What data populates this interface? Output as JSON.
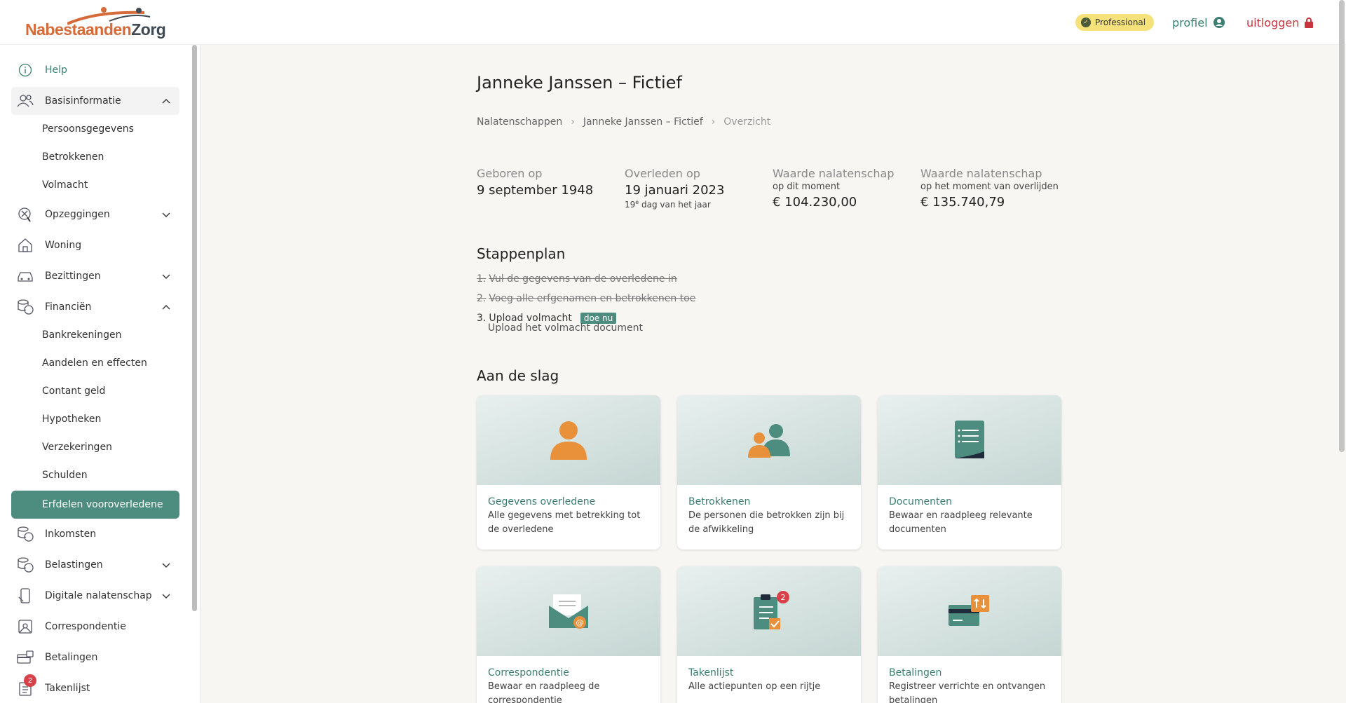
{
  "brand": {
    "part1": "Nabestaanden",
    "part2": "Zorg"
  },
  "header": {
    "badge": "Professional",
    "profile_label": "profiel",
    "logout_label": "uitloggen"
  },
  "sidebar": {
    "help": "Help",
    "basis": "Basisinformatie",
    "basis_items": [
      "Persoonsgegevens",
      "Betrokkenen",
      "Volmacht"
    ],
    "opzeggingen": "Opzeggingen",
    "woning": "Woning",
    "bezittingen": "Bezittingen",
    "financien": "Financiën",
    "financien_items": [
      "Bankrekeningen",
      "Aandelen en effecten",
      "Contant geld",
      "Hypotheken",
      "Verzekeringen",
      "Schulden",
      "Erfdelen vooroverledene"
    ],
    "inkomsten": "Inkomsten",
    "belastingen": "Belastingen",
    "digitaal": "Digitale nalatenschap",
    "correspondentie": "Correspondentie",
    "betalingen": "Betalingen",
    "takenlijst": "Takenlijst",
    "takenlijst_badge": "2"
  },
  "page": {
    "title": "Janneke Janssen – Fictief",
    "breadcrumb": [
      "Nalatenschappen",
      "Janneke Janssen – Fictief",
      "Overzicht"
    ]
  },
  "facts": {
    "born_label": "Geboren op",
    "born_value": "9 september 1948",
    "died_label": "Overleden op",
    "died_value": "19 januari 2023",
    "died_note_num": "19",
    "died_note_sup": "e",
    "died_note_text": "dag van het jaar",
    "value_now_label": "Waarde nalatenschap",
    "value_now_sub": "op dit moment",
    "value_now": "€ 104.230,00",
    "value_death_label": "Waarde nalatenschap",
    "value_death_sub": "op het moment van overlijden",
    "value_death": "€ 135.740,79"
  },
  "stappenplan": {
    "title": "Stappenplan",
    "steps": [
      {
        "num": "1.",
        "text": "Vul de gegevens van de overledene in"
      },
      {
        "num": "2.",
        "text": "Voeg alle erfgenamen en betrokkenen toe"
      },
      {
        "num": "3.",
        "text": "Upload volmacht",
        "action": "doe nu",
        "sub": "Upload het volmacht document"
      }
    ]
  },
  "aan_de_slag": {
    "title": "Aan de slag",
    "cards": [
      {
        "title": "Gegevens overledene",
        "desc": "Alle gegevens met betrekking tot de overledene",
        "icon": "person-icon"
      },
      {
        "title": "Betrokkenen",
        "desc": "De personen die betrokken zijn bij de afwikkeling",
        "icon": "people-icon"
      },
      {
        "title": "Documenten",
        "desc": "Bewaar en raadpleeg relevante documenten",
        "icon": "document-icon"
      },
      {
        "title": "Correspondentie",
        "desc": "Bewaar en raadpleeg de correspondentie",
        "icon": "mail-icon"
      },
      {
        "title": "Takenlijst",
        "desc": "Alle actiepunten op een rijtje",
        "icon": "clipboard-icon",
        "badge": "2"
      },
      {
        "title": "Betalingen",
        "desc": "Registreer verrichte en ontvangen betalingen",
        "icon": "payment-icon"
      }
    ]
  },
  "colors": {
    "accent": "#4c8d80",
    "orange": "#e8903a",
    "red": "#c8343d"
  }
}
